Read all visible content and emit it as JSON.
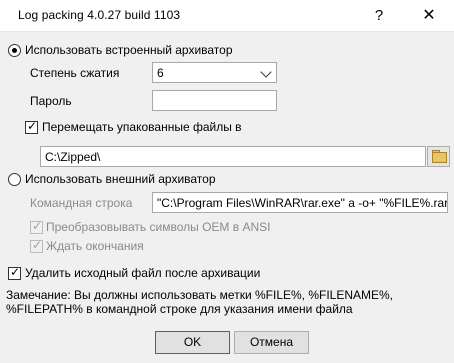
{
  "window": {
    "title": "Log packing 4.0.27 build 1103",
    "help_glyph": "?",
    "close_glyph": "✕"
  },
  "builtin": {
    "label": "Использовать встроенный архиватор",
    "selected": true,
    "compression_label": "Степень сжатия",
    "compression_value": "6",
    "password_label": "Пароль",
    "password_value": "",
    "move_label": "Перемещать упакованные файлы в",
    "move_checked": true,
    "move_path": "C:\\Zipped\\"
  },
  "external": {
    "label": "Использовать внешний архиватор",
    "selected": false,
    "command_label": "Командная строка",
    "command_value": "\"C:\\Program Files\\WinRAR\\rar.exe\" a -o+ \"%FILE%.rar\" \"%FI",
    "oem_label": "Преобразовывать символы OEM в ANSI",
    "oem_checked": true,
    "wait_label": "Ждать окончания",
    "wait_checked": true
  },
  "delete_source": {
    "label": "Удалить исходный файл после архивации",
    "checked": true
  },
  "note": "Замечание: Вы должны использовать метки %FILE%, %FILENAME%, %FILEPATH% в командной строке для указания имени файла",
  "buttons": {
    "ok": "OK",
    "cancel": "Отмена"
  },
  "colors": {
    "background": "#f0f0f0",
    "default_button_border": "#0078d7"
  },
  "icons": {
    "browse": "folder-icon",
    "checkbox_mark": "✓"
  }
}
